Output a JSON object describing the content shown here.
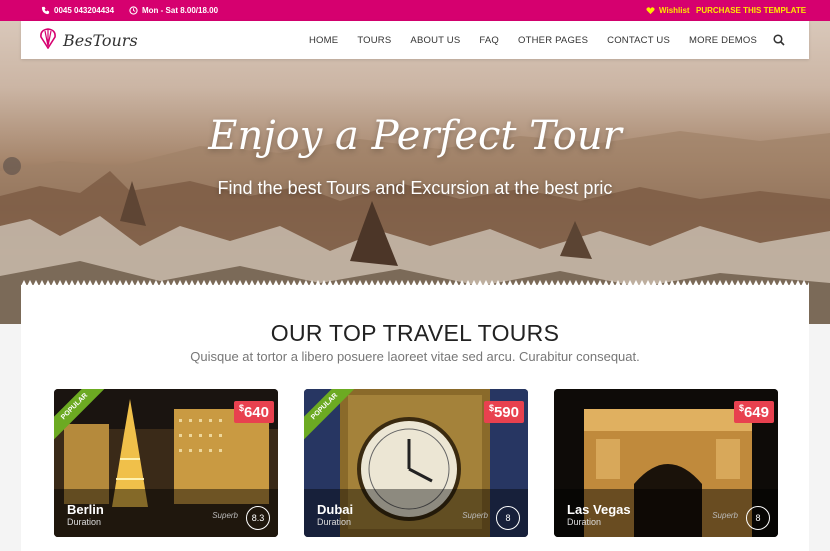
{
  "topbar": {
    "phone": "0045 043204434",
    "hours": "Mon - Sat 8.00/18.00",
    "wishlist": "Wishlist",
    "purchase": "PURCHASE THIS TEMPLATE"
  },
  "header": {
    "logo_text": "BesTours",
    "nav": [
      "HOME",
      "TOURS",
      "ABOUT US",
      "FAQ",
      "OTHER PAGES",
      "CONTACT US",
      "MORE DEMOS"
    ]
  },
  "hero": {
    "title": "Enjoy a Perfect Tour",
    "subtitle": "Find the best Tours and Excursion at the best pric"
  },
  "section": {
    "title": "OUR TOP TRAVEL TOURS",
    "subtitle": "Quisque at tortor a libero posuere laoreet vitae sed arcu. Curabitur consequat."
  },
  "tours": [
    {
      "name": "Berlin",
      "duration": "Duration",
      "currency": "$",
      "price": "640",
      "popular": "POPULAR",
      "rating_label": "Superb",
      "score": "8.3"
    },
    {
      "name": "Dubai",
      "duration": "Duration",
      "currency": "$",
      "price": "590",
      "popular": "POPULAR",
      "rating_label": "Superb",
      "score": "8"
    },
    {
      "name": "Las Vegas",
      "duration": "Duration",
      "currency": "$",
      "price": "649",
      "popular": "",
      "rating_label": "Superb",
      "score": "8"
    }
  ],
  "colors": {
    "brand": "#d6006f",
    "accent": "#ffe600",
    "price": "#e8414f",
    "ribbon": "#6caa22"
  }
}
